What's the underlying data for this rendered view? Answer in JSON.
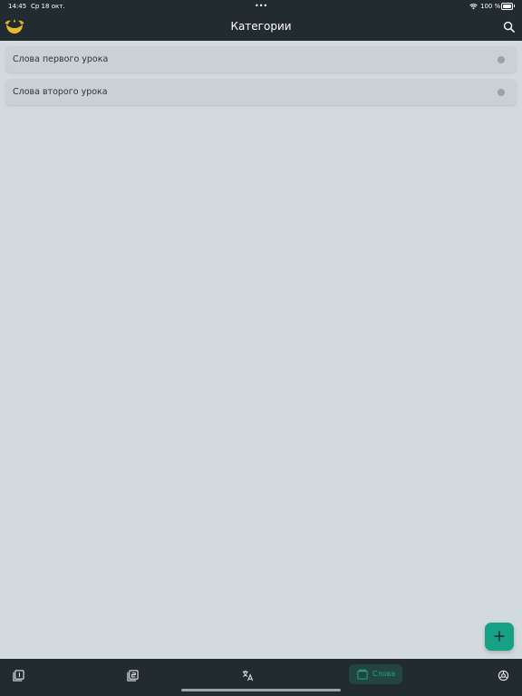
{
  "status_bar": {
    "time": "14:45",
    "date": "Ср 18 окт.",
    "multitask_dots": "•••",
    "battery_percent": "100 %",
    "wifi_icon": "wifi-icon",
    "battery_icon": "battery-icon"
  },
  "header": {
    "title": "Категории",
    "logo_icon": "app-logo-icon",
    "search_icon": "search-icon"
  },
  "categories": [
    {
      "label": "Слова первого урока",
      "status_icon": "status-dot-icon"
    },
    {
      "label": "Слова второго урока",
      "status_icon": "status-dot-icon"
    }
  ],
  "fab": {
    "icon": "plus-icon"
  },
  "tab_bar": {
    "tabs": [
      {
        "icon": "cards-one-icon"
      },
      {
        "icon": "cards-two-icon"
      },
      {
        "icon": "translate-icon"
      },
      {
        "icon": "folder-icon",
        "label": "Слова",
        "active": true
      },
      {
        "icon": "settings-icon"
      }
    ]
  },
  "colors": {
    "background": "#d3dadd",
    "bar": "#222b30",
    "card": "#c9d1d7",
    "accent": "#16a184",
    "logo": "#e8b92c"
  }
}
